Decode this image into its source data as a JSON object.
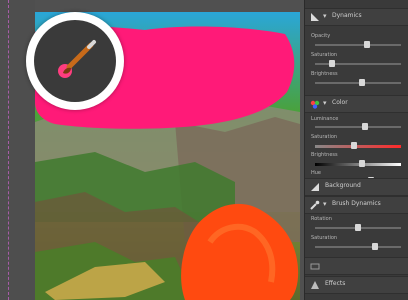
{
  "panel": {
    "sections": [
      {
        "title": "Dynamics",
        "sliders": [
          {
            "label": "Opacity",
            "value": 0.6
          },
          {
            "label": "Saturation",
            "value": 0.2
          },
          {
            "label": "Brightness",
            "value": 0.55
          }
        ]
      },
      {
        "title": "Color",
        "sliders": [
          {
            "label": "Luminance",
            "value": 0.58
          },
          {
            "label": "Saturation",
            "value": 0.45
          },
          {
            "label": "Brightness",
            "value": 0.55
          },
          {
            "label": "Hue",
            "value": 0.65
          }
        ]
      },
      {
        "title": "Background",
        "sliders": []
      },
      {
        "title": "Brush Dynamics",
        "sliders": [
          {
            "label": "Rotation",
            "value": 0.5
          },
          {
            "label": "Saturation",
            "value": 0.7
          }
        ]
      },
      {
        "title": "",
        "sliders": []
      },
      {
        "title": "Effects",
        "sliders": []
      }
    ]
  },
  "colors": {
    "magenta": "#ff1a78",
    "orange": "#ff4a10",
    "panel": "#3a3a3a"
  },
  "icons": {
    "badge": "paintbrush-icon"
  }
}
